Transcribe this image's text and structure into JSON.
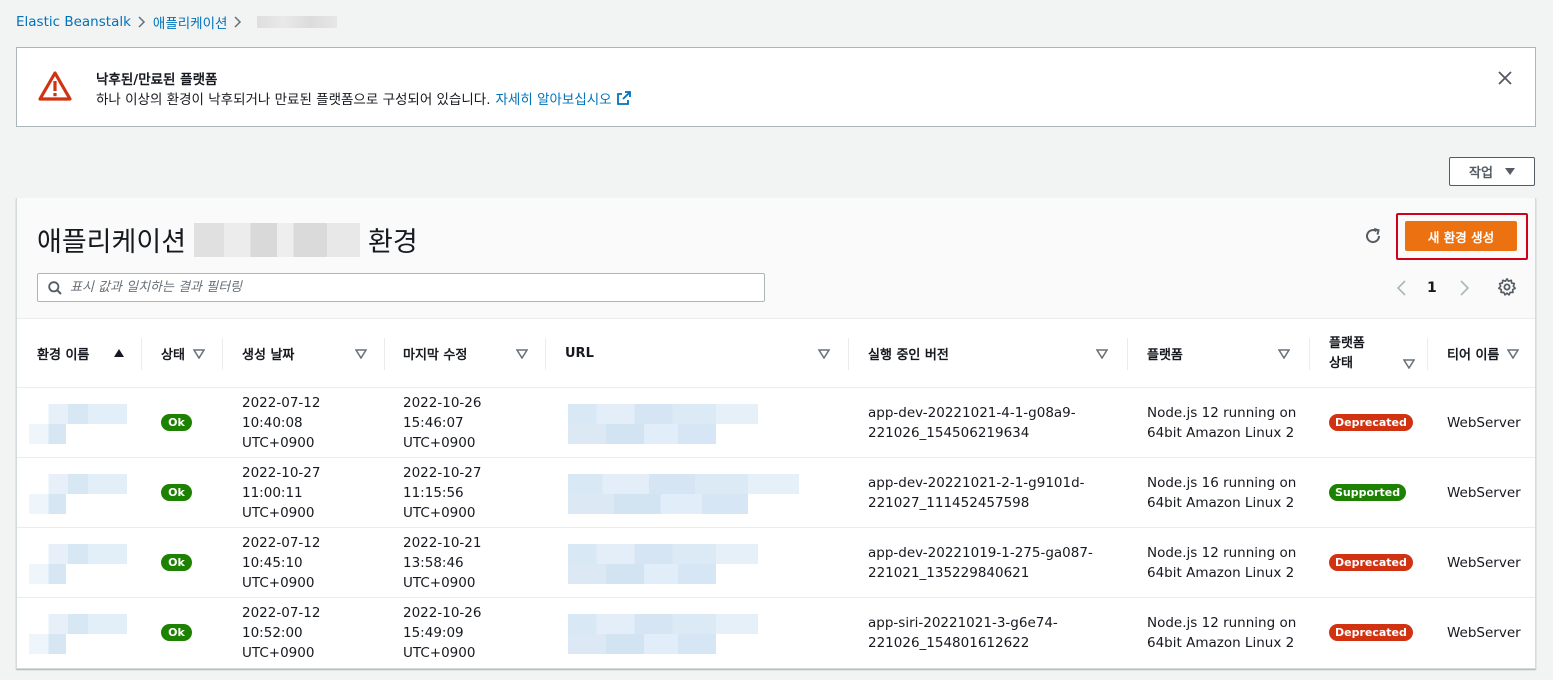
{
  "breadcrumb": {
    "items": [
      "Elastic Beanstalk",
      "애플리케이션"
    ]
  },
  "flash": {
    "title": "낙후된/만료된 플랫폼",
    "message": "하나 이상의 환경이 낙후되거나 만료된 플랫폼으로 구성되어 있습니다.",
    "link": "자세히 알아보십시오",
    "type": "error",
    "icon": "warning-icon"
  },
  "actions_button": {
    "label": "작업"
  },
  "panel": {
    "title_prefix": "애플리케이션",
    "title_suffix": "환경",
    "create_button": "새 환경 생성",
    "filter_placeholder": "표시 값과 일치하는 결과 필터링",
    "page": "1"
  },
  "colors": {
    "accent": "#ec7211",
    "link": "#0073bb",
    "ok": "#1d8102",
    "deprecated": "#d13212",
    "supported": "#1d8102",
    "highlight_frame": "#d0021b"
  },
  "table": {
    "headers": {
      "name": "환경 이름",
      "status": "상태",
      "created": "생성 날짜",
      "modified": "마지막 수정",
      "url": "URL",
      "version": "실행 중인 버전",
      "platform": "플랫폼",
      "platform_status_1": "플랫폼",
      "platform_status_2": "상태",
      "tier": "티어 이름"
    },
    "rows": [
      {
        "status": "Ok",
        "created": [
          "2022-07-12",
          "10:40:08",
          "UTC+0900"
        ],
        "modified": [
          "2022-10-26",
          "15:46:07",
          "UTC+0900"
        ],
        "version": [
          "app-dev-20221021-4-1-g08a9-",
          "221026_154506219634"
        ],
        "platform": [
          "Node.js 12 running on",
          "64bit Amazon Linux 2"
        ],
        "platform_status": "Deprecated",
        "tier": "WebServer"
      },
      {
        "status": "Ok",
        "created": [
          "2022-10-27",
          "11:00:11",
          "UTC+0900"
        ],
        "modified": [
          "2022-10-27",
          "11:15:56",
          "UTC+0900"
        ],
        "version": [
          "app-dev-20221021-2-1-g9101d-",
          "221027_111452457598"
        ],
        "platform": [
          "Node.js 16 running on",
          "64bit Amazon Linux 2"
        ],
        "platform_status": "Supported",
        "tier": "WebServer"
      },
      {
        "status": "Ok",
        "created": [
          "2022-07-12",
          "10:45:10",
          "UTC+0900"
        ],
        "modified": [
          "2022-10-21",
          "13:58:46",
          "UTC+0900"
        ],
        "version": [
          "app-dev-20221019-1-275-ga087-",
          "221021_135229840621"
        ],
        "platform": [
          "Node.js 12 running on",
          "64bit Amazon Linux 2"
        ],
        "platform_status": "Deprecated",
        "tier": "WebServer"
      },
      {
        "status": "Ok",
        "created": [
          "2022-07-12",
          "10:52:00",
          "UTC+0900"
        ],
        "modified": [
          "2022-10-26",
          "15:49:09",
          "UTC+0900"
        ],
        "version": [
          "app-siri-20221021-3-g6e74-",
          "221026_154801612622"
        ],
        "platform": [
          "Node.js 12 running on",
          "64bit Amazon Linux 2"
        ],
        "platform_status": "Deprecated",
        "tier": "WebServer"
      }
    ]
  }
}
